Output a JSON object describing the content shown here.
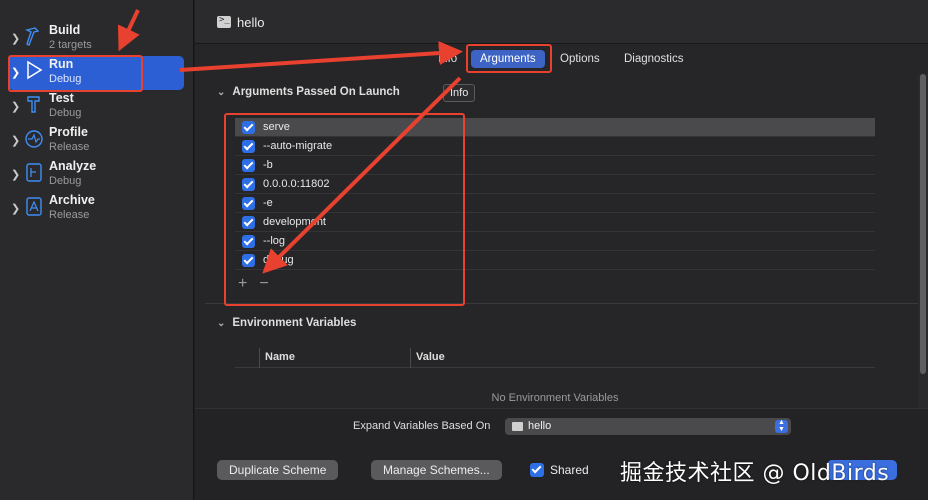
{
  "window": {
    "title": "hello"
  },
  "sidebar": {
    "items": [
      {
        "name": "Build",
        "sub": "2 targets",
        "icon": "hammer-icon"
      },
      {
        "name": "Run",
        "sub": "Debug",
        "icon": "play-icon"
      },
      {
        "name": "Test",
        "sub": "Debug",
        "icon": "wrench-icon"
      },
      {
        "name": "Profile",
        "sub": "Release",
        "icon": "gauge-icon"
      },
      {
        "name": "Analyze",
        "sub": "Debug",
        "icon": "analyze-icon"
      },
      {
        "name": "Archive",
        "sub": "Release",
        "icon": "archive-icon"
      }
    ]
  },
  "tabs": [
    "Info",
    "Arguments",
    "Options",
    "Diagnostics"
  ],
  "tooltip": "Info",
  "arguments": {
    "heading": "Arguments Passed On Launch",
    "rows": [
      "serve",
      "--auto-migrate",
      "-b",
      "0.0.0.0:11802",
      "-e",
      "development",
      "--log",
      "debug"
    ],
    "add_label": "+",
    "remove_label": "−"
  },
  "environment": {
    "heading": "Environment Variables",
    "col_name": "Name",
    "col_value": "Value",
    "empty": "No Environment Variables"
  },
  "expand": {
    "label": "Expand Variables Based On",
    "value": "hello"
  },
  "bottom": {
    "duplicate": "Duplicate Scheme",
    "manage": "Manage Schemes...",
    "shared": "Shared"
  },
  "watermark": "掘金技术社区 @ OldBirds",
  "colors": {
    "accent": "#2d5fd4",
    "annotation": "#e8412f"
  }
}
